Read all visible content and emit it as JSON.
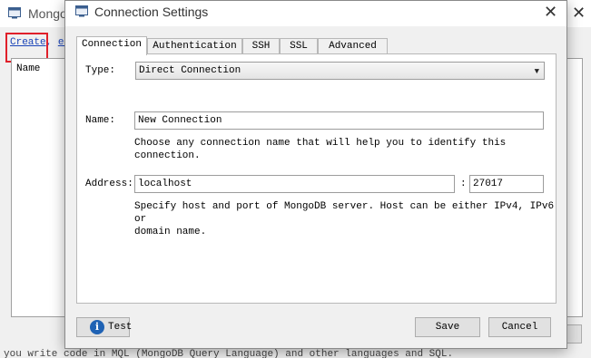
{
  "background_window": {
    "title": "Mongo",
    "links": {
      "create": "Create",
      "separator": ",",
      "edit": "ed"
    },
    "list": {
      "column_header": "Name"
    },
    "status_text": "you write code in MQL (MongoDB Query Language) and other languages and SQL.",
    "highlight_color": "#e0202a"
  },
  "dialog": {
    "title": "Connection Settings",
    "tabs": [
      {
        "label": "Connection",
        "active": true
      },
      {
        "label": "Authentication",
        "active": false
      },
      {
        "label": "SSH",
        "active": false
      },
      {
        "label": "SSL",
        "active": false
      },
      {
        "label": "Advanced",
        "active": false
      }
    ],
    "connection": {
      "type_label": "Type:",
      "type_value": "Direct Connection",
      "name_label": "Name:",
      "name_value": "New Connection",
      "name_help": "Choose any connection name that will help you to identify this connection.",
      "address_label": "Address:",
      "host_value": "localhost",
      "port_separator": ":",
      "port_value": "27017",
      "address_help_line1": "Specify host and port of MongoDB server. Host can be either IPv4, IPv6 or",
      "address_help_line2": "domain name."
    },
    "buttons": {
      "test": "Test",
      "save": "Save",
      "cancel": "Cancel"
    },
    "icons": {
      "title_icon": "window-app-icon",
      "close": "close-icon",
      "test": "info-icon"
    }
  }
}
